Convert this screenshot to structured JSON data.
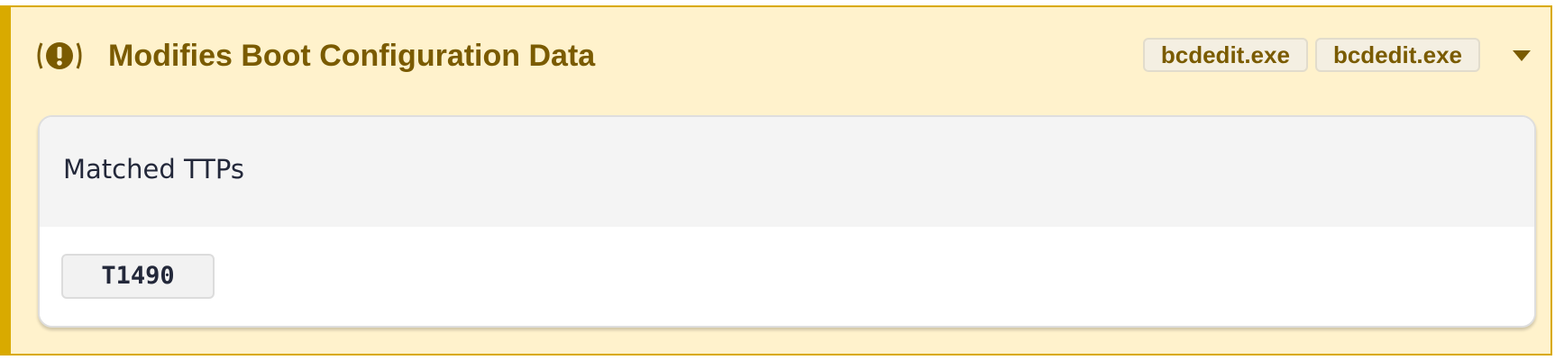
{
  "signature": {
    "title": "Modifies Boot Configuration Data",
    "severity_icon": "exclamation-circle-icon",
    "tags": [
      "bcdedit.exe",
      "bcdedit.exe"
    ],
    "expand_icon": "caret-down-icon",
    "accent_color": "#d9aa00",
    "background_color": "#fff2cc",
    "text_color": "#7a5b00"
  },
  "ttp_card": {
    "title": "Matched TTPs",
    "items": [
      "T1490"
    ]
  }
}
